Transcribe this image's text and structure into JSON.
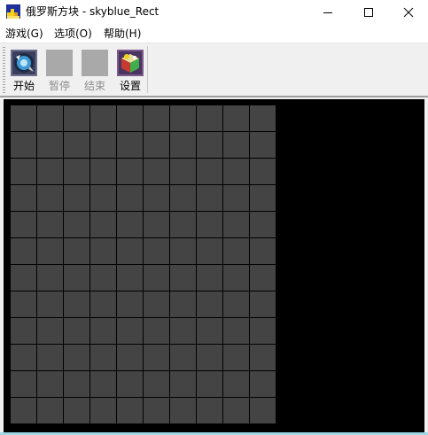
{
  "window": {
    "title": "俄罗斯方块 - skyblue_Rect",
    "icon": "tetris-app-icon",
    "controls": {
      "minimize": "minimize-icon",
      "maximize": "maximize-icon",
      "close": "close-icon"
    }
  },
  "menu": {
    "items": [
      {
        "label": "游戏(G)"
      },
      {
        "label": "选项(O)"
      },
      {
        "label": "帮助(H)"
      }
    ]
  },
  "toolbar": {
    "buttons": [
      {
        "label": "开始",
        "icon": "start-icon",
        "enabled": true
      },
      {
        "label": "暂停",
        "icon": "pause-icon",
        "enabled": false
      },
      {
        "label": "结束",
        "icon": "stop-icon",
        "enabled": false
      },
      {
        "label": "设置",
        "icon": "settings-icon",
        "enabled": true
      }
    ]
  },
  "board": {
    "columns": 10,
    "rows": 12,
    "cell_color": "#444444",
    "background_color": "#000000"
  },
  "colors": {
    "disabled_icon": "#a9a9a9",
    "disabled_text": "#8d8d8d",
    "toolbar_bg": "#f0f0f0"
  }
}
